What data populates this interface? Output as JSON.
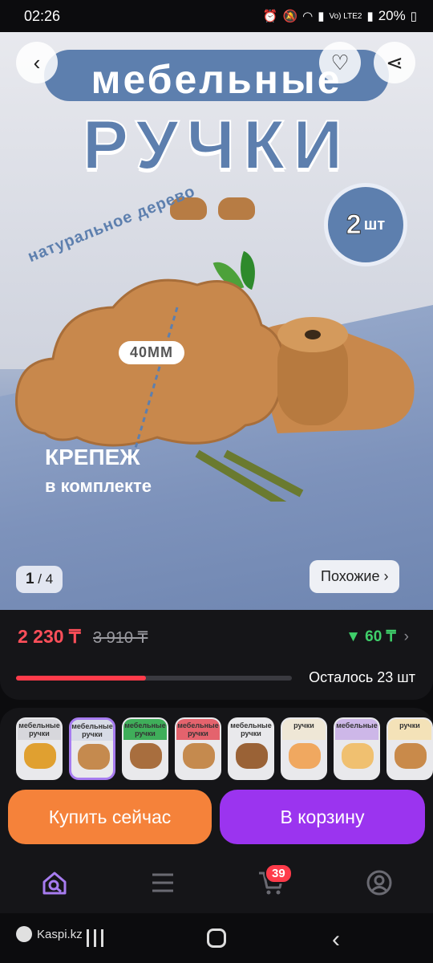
{
  "status_bar": {
    "time": "02:26",
    "network": "Vo) LTE2",
    "battery": "20%"
  },
  "hero": {
    "title_top": "мебельные",
    "title_main": "РУЧКИ",
    "count_badge_number": "2",
    "count_badge_unit": "шт",
    "material_label": "натуральное дерево",
    "dimension_label": "40MM",
    "fastener_title": "КРЕПЕЖ",
    "fastener_subtitle": "в комплекте",
    "page_current": "1",
    "page_total": "4",
    "similar_label": "Похожие ›"
  },
  "price": {
    "current": "2 230 ₸",
    "old": "3 910 ₸",
    "bonus": "▼ 60 ₸",
    "stock_text": "Осталось 23 шт",
    "stock_progress": 0.47
  },
  "thumbnails": [
    {
      "label": "мебельные ручки",
      "band_color": "#d7d7dc",
      "blob_color": "#e0a030"
    },
    {
      "label": "мебельные ручки",
      "band_color": "#d7dbe6",
      "blob_color": "#c58a4e"
    },
    {
      "label": "мебельные ручки",
      "band_color": "#3fae5a",
      "blob_color": "#a86e3e"
    },
    {
      "label": "мебельные ручки",
      "band_color": "#e4636d",
      "blob_color": "#c58a4e"
    },
    {
      "label": "мебельные ручки",
      "band_color": "#e9e9ec",
      "blob_color": "#9a6236"
    },
    {
      "label": "ручки",
      "band_color": "#efe7d6",
      "blob_color": "#f0a860"
    },
    {
      "label": "мебельные",
      "band_color": "#cdb7e8",
      "blob_color": "#f0c070"
    },
    {
      "label": "ручки",
      "band_color": "#f4e2b8",
      "blob_color": "#c98a4a"
    }
  ],
  "actions": {
    "buy_now": "Купить сейчас",
    "add_to_cart": "В корзину"
  },
  "tabbar": {
    "cart_count": "39"
  },
  "navbar": {
    "watermark": "Kaspi.kz"
  },
  "colors": {
    "price_red": "#ff4f5a",
    "bonus_green": "#3fcf6a",
    "buy_orange": "#f5823a",
    "cart_purple": "#9b34ef",
    "selected_thumb_border": "#a77cf0"
  }
}
